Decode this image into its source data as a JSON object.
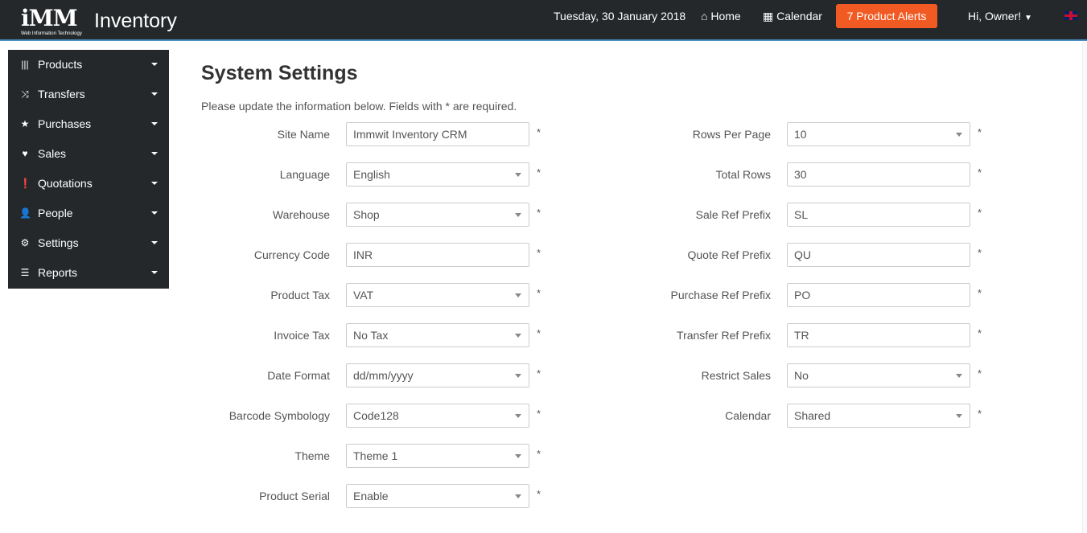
{
  "header": {
    "logo_text": "iMM",
    "logo_subtext": "Web Information Technology",
    "brand": "Inventory",
    "date": "Tuesday, 30 January 2018",
    "home_label": "Home",
    "calendar_label": "Calendar",
    "alerts_label": "7 Product Alerts",
    "alerts_color": "#f15a22",
    "user_label": "Hi, Owner!",
    "language_flag": "uk-flag-icon"
  },
  "sidebar": {
    "items": [
      {
        "label": "Products",
        "icon": "barcode-icon"
      },
      {
        "label": "Transfers",
        "icon": "random-icon"
      },
      {
        "label": "Purchases",
        "icon": "star-icon"
      },
      {
        "label": "Sales",
        "icon": "heart-icon"
      },
      {
        "label": "Quotations",
        "icon": "exclamation-icon"
      },
      {
        "label": "People",
        "icon": "user-icon"
      },
      {
        "label": "Settings",
        "icon": "gear-icon"
      },
      {
        "label": "Reports",
        "icon": "list-icon"
      }
    ]
  },
  "main": {
    "title": "System Settings",
    "intro": "Please update the information below. Fields with * are required.",
    "required_mark": "*",
    "left_fields": [
      {
        "label": "Site Name",
        "value": "Immwit Inventory CRM",
        "type": "text"
      },
      {
        "label": "Language",
        "value": "English",
        "type": "select"
      },
      {
        "label": "Warehouse",
        "value": "Shop",
        "type": "select"
      },
      {
        "label": "Currency Code",
        "value": "INR",
        "type": "text"
      },
      {
        "label": "Product Tax",
        "value": "VAT",
        "type": "select"
      },
      {
        "label": "Invoice Tax",
        "value": "No Tax",
        "type": "select"
      },
      {
        "label": "Date Format",
        "value": "dd/mm/yyyy",
        "type": "select"
      },
      {
        "label": "Barcode Symbology",
        "value": "Code128",
        "type": "select"
      },
      {
        "label": "Theme",
        "value": "Theme 1",
        "type": "select"
      },
      {
        "label": "Product Serial",
        "value": "Enable",
        "type": "select"
      }
    ],
    "right_fields": [
      {
        "label": "Rows Per Page",
        "value": "10",
        "type": "select"
      },
      {
        "label": "Total Rows",
        "value": "30",
        "type": "text"
      },
      {
        "label": "Sale Ref Prefix",
        "value": "SL",
        "type": "text"
      },
      {
        "label": "Quote Ref Prefix",
        "value": "QU",
        "type": "text"
      },
      {
        "label": "Purchase Ref Prefix",
        "value": "PO",
        "type": "text"
      },
      {
        "label": "Transfer Ref Prefix",
        "value": "TR",
        "type": "text"
      },
      {
        "label": "Restrict Sales",
        "value": "No",
        "type": "select"
      },
      {
        "label": "Calendar",
        "value": "Shared",
        "type": "select"
      }
    ]
  }
}
